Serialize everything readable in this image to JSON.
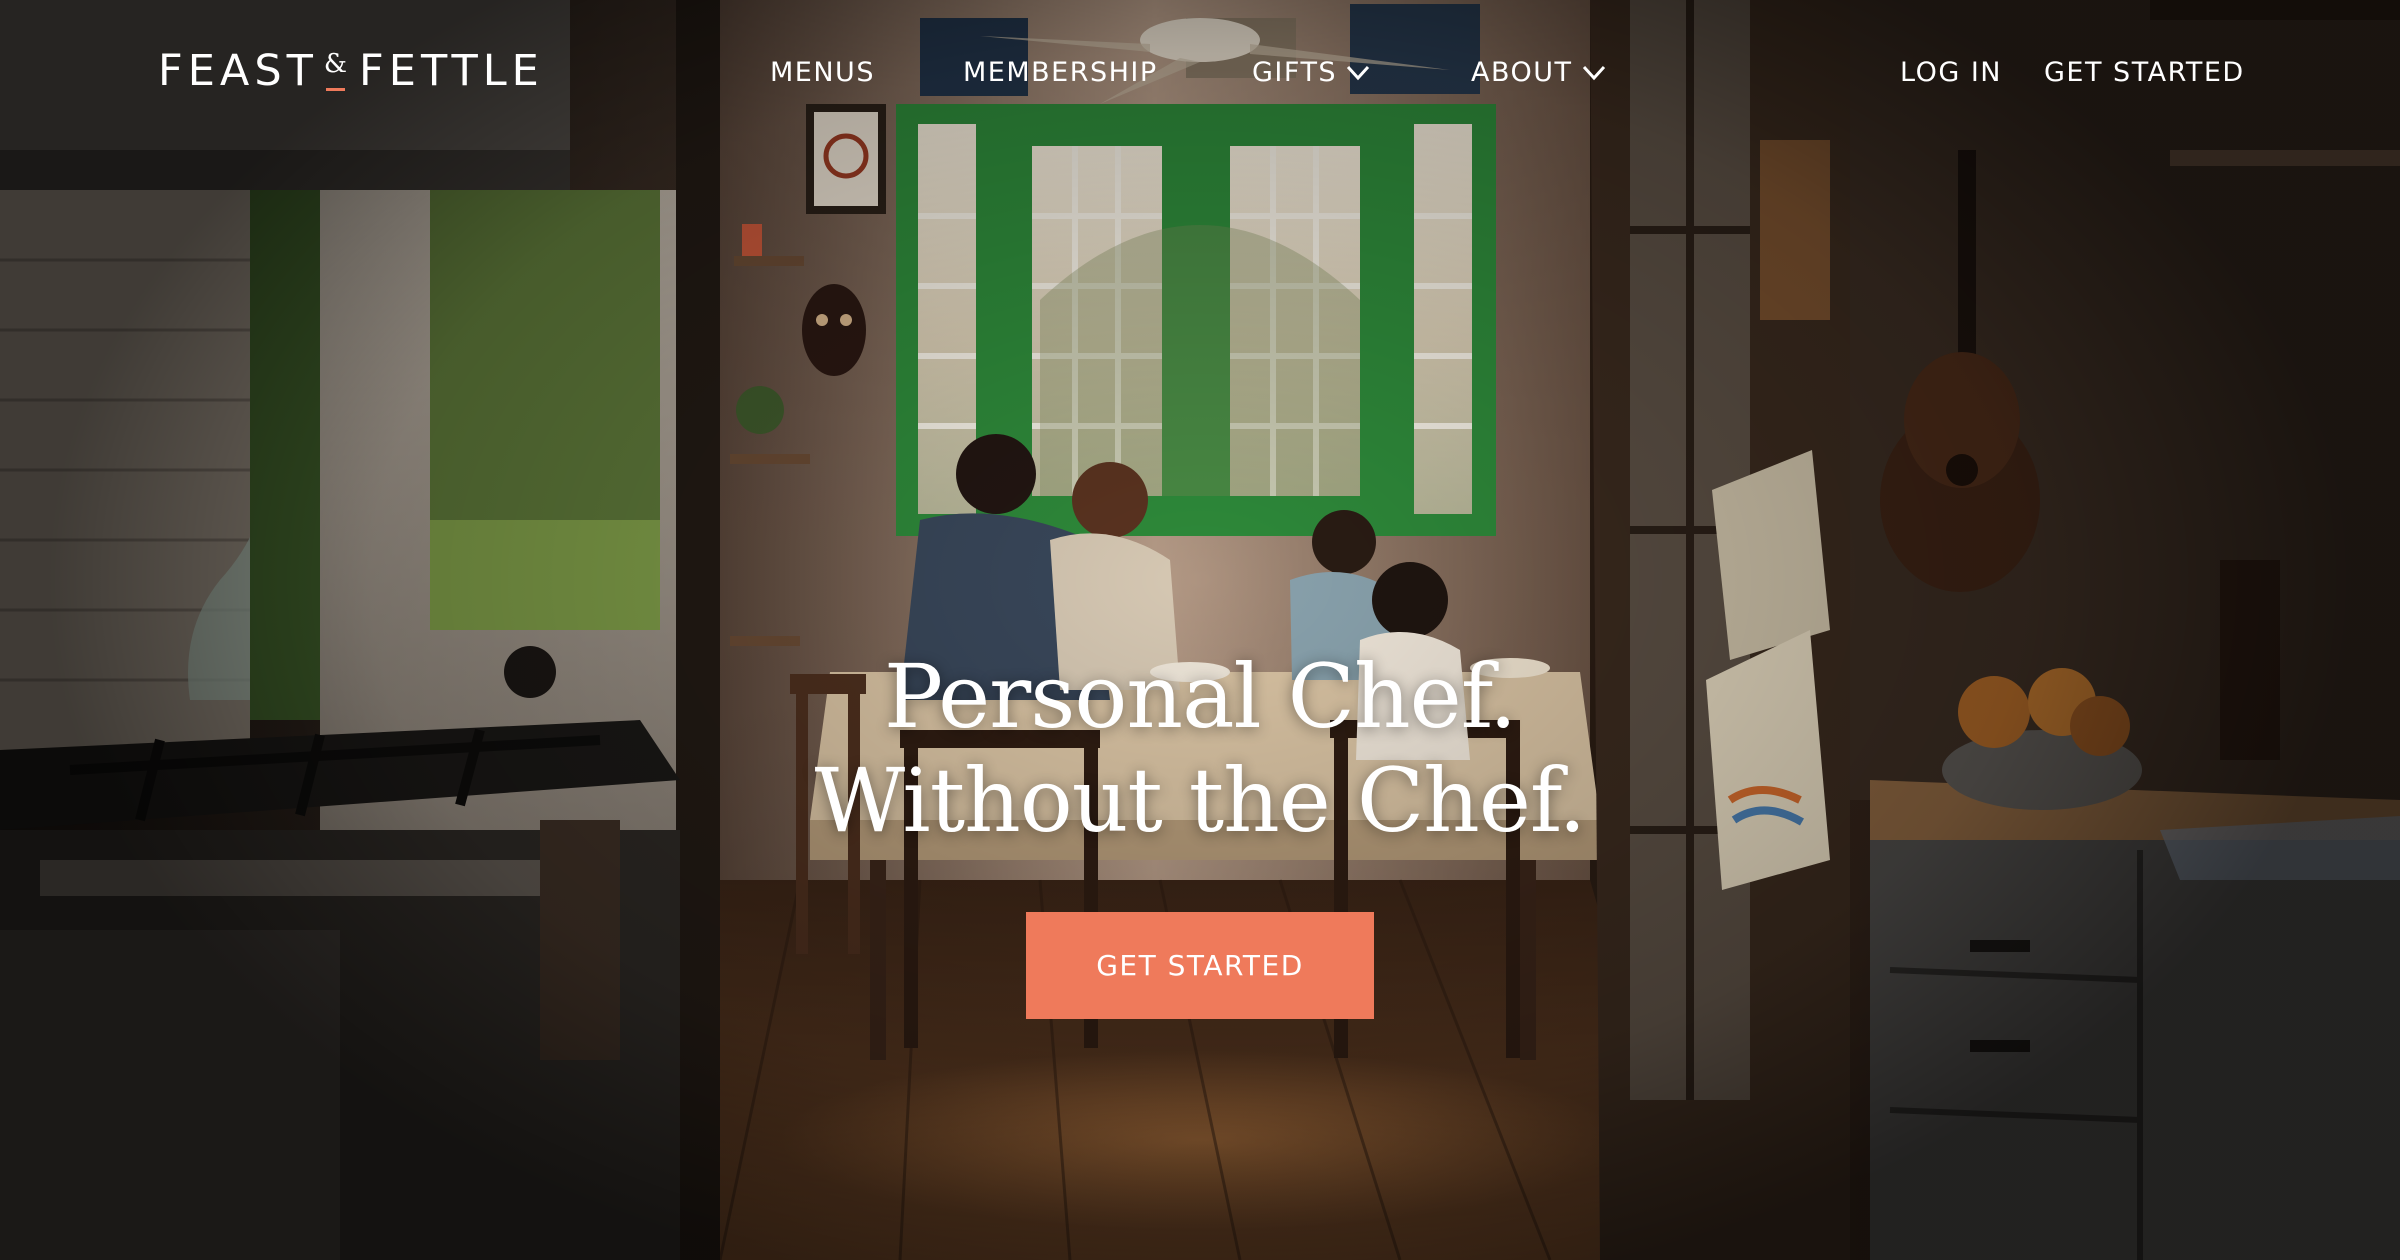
{
  "brand": {
    "name_left": "FEAST",
    "name_amp": "&",
    "name_right": "FETTLE"
  },
  "nav": {
    "menus": "MENUS",
    "membership": "MEMBERSHIP",
    "gifts": "GIFTS",
    "about": "ABOUT",
    "login": "LOG IN",
    "get_started": "GET STARTED"
  },
  "hero": {
    "headline_line1": "Personal Chef.",
    "headline_line2": "Without the Chef.",
    "cta_label": "GET STARTED"
  },
  "colors": {
    "accent": "#ef7a5b",
    "window_frame": "#2e8a3a",
    "text": "#ffffff"
  },
  "icons": {
    "dropdown": "chevron-down-icon"
  }
}
